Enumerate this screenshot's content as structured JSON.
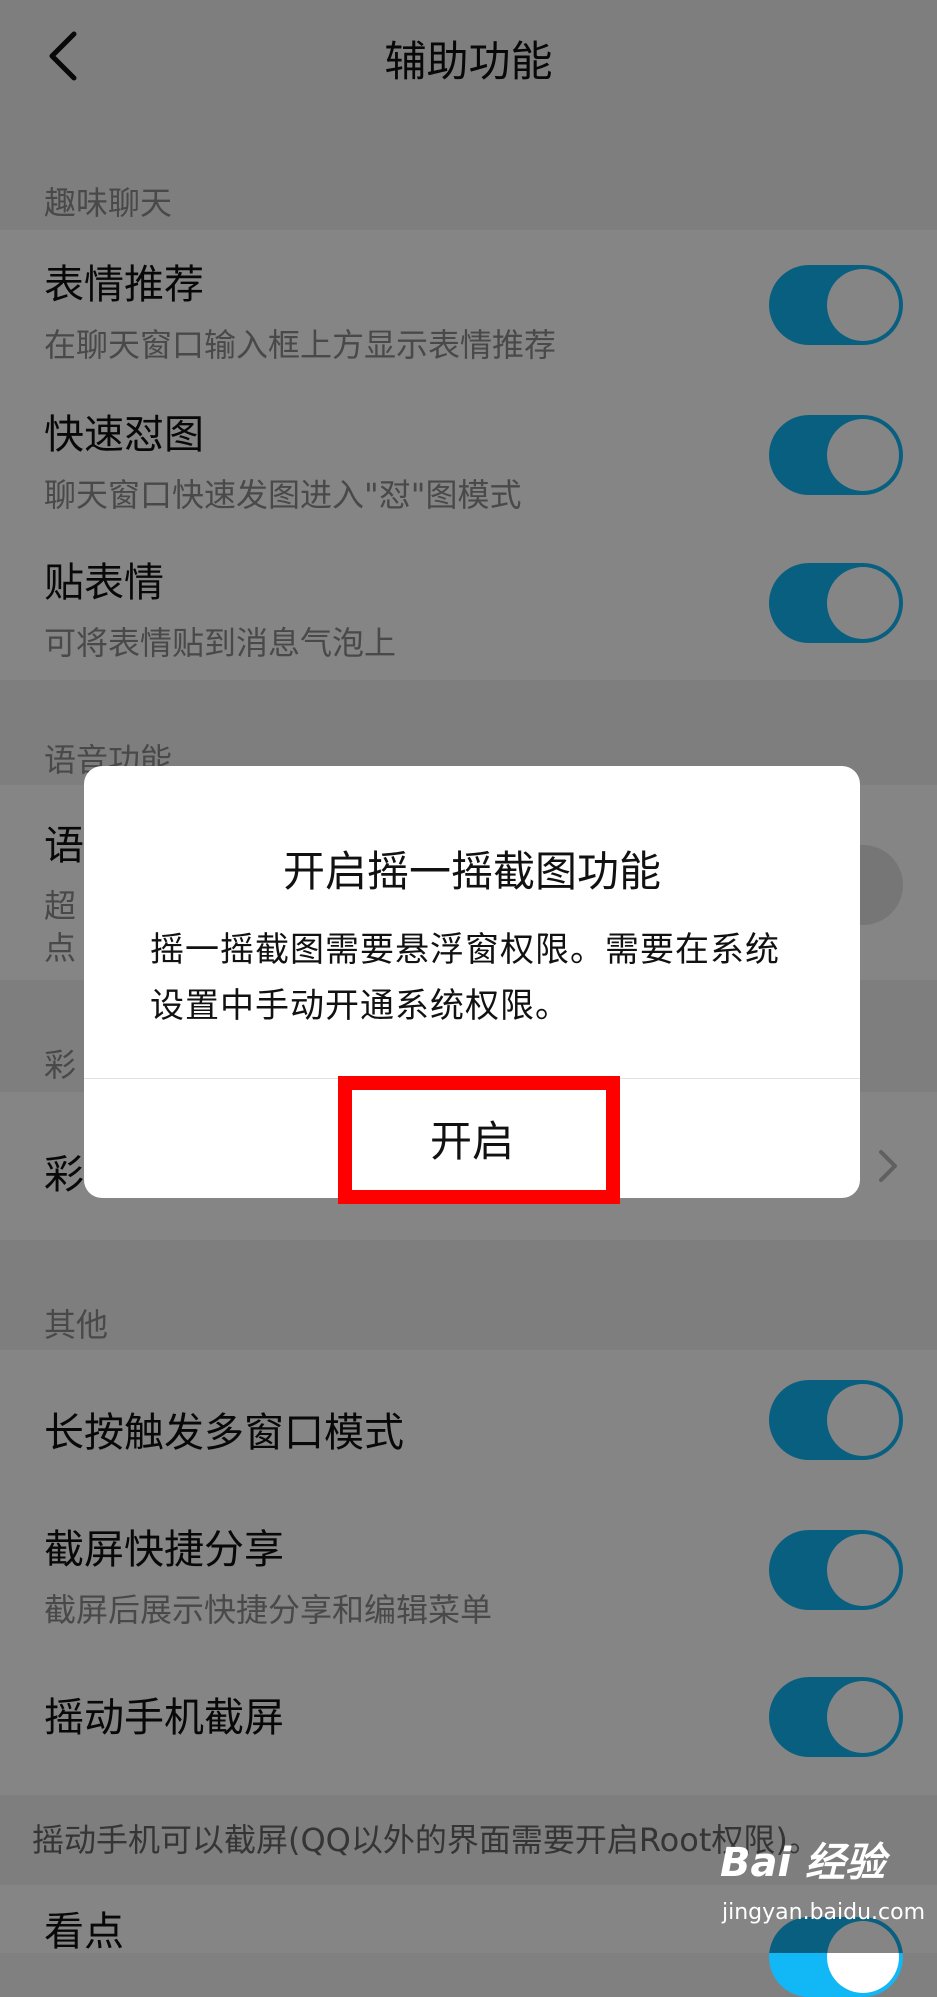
{
  "nav": {
    "title": "辅助功能",
    "back_icon": "chevron-left-icon"
  },
  "sections": {
    "fun_chat": "趣味聊天",
    "voice": "语音功能",
    "color": "彩",
    "other": "其他"
  },
  "rows": {
    "emoji_recommend": {
      "title": "表情推荐",
      "sub": "在聊天窗口输入框上方显示表情推荐",
      "on": true
    },
    "quick_image": {
      "title": "快速怼图",
      "sub": "聊天窗口快速发图进入\"怼\"图模式",
      "on": true
    },
    "sticker": {
      "title": "贴表情",
      "sub": "可将表情贴到消息气泡上",
      "on": true
    },
    "voice_row": {
      "title": "语",
      "sub1": "超",
      "sub2": "点",
      "on": false
    },
    "color_row": {
      "title": "彩"
    },
    "multi_window": {
      "title": "长按触发多窗口模式",
      "on": true
    },
    "screenshot_share": {
      "title": "截屏快捷分享",
      "sub": "截屏后展示快捷分享和编辑菜单",
      "on": true
    },
    "shake_screenshot": {
      "title": "摇动手机截屏",
      "on": true
    },
    "kandian": {
      "title": "看点",
      "on": true
    }
  },
  "footer_note": "摇动手机可以截屏(QQ以外的界面需要开启Root权限)。",
  "dialog": {
    "title": "开启摇一摇截图功能",
    "body": "摇一摇截图需要悬浮窗权限。需要在系统设置中手动开通系统权限。",
    "button": "开启"
  },
  "colors": {
    "accent": "#12b7f5",
    "highlight": "#ff0000"
  },
  "watermark": {
    "logo": "Bai 经验",
    "url": "jingyan.baidu.com"
  }
}
